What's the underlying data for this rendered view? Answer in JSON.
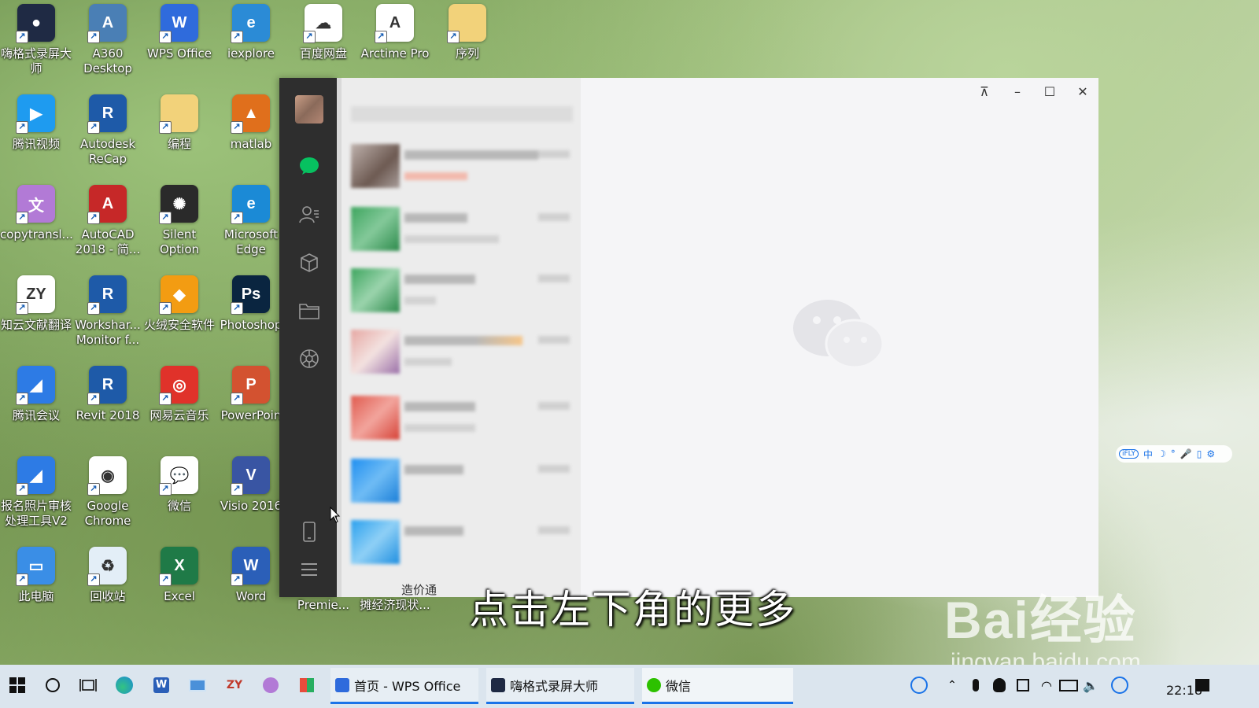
{
  "desktop_icons": [
    {
      "label": "嗨格式录屏大\n师",
      "icon": "screen-recorder-icon",
      "color": "#1f2a44",
      "glyph": "●"
    },
    {
      "label": "A360\nDesktop",
      "icon": "a360-icon",
      "color": "#4a7fb5",
      "glyph": "A"
    },
    {
      "label": "WPS Office",
      "icon": "wps-icon",
      "color": "#2f6bdc",
      "glyph": "W"
    },
    {
      "label": "iexplore",
      "icon": "internet-explorer-icon",
      "color": "#2b8bd6",
      "glyph": "e"
    },
    {
      "label": "百度网盘",
      "icon": "baidu-netdisk-icon",
      "color": "#ffffff",
      "glyph": "☁"
    },
    {
      "label": "Arctime Pro",
      "icon": "arctime-icon",
      "color": "#ffffff",
      "glyph": "A"
    },
    {
      "label": "序列",
      "icon": "folder-icon",
      "color": "#f2d27a",
      "glyph": ""
    },
    {
      "label": "腾讯视频",
      "icon": "tencent-video-icon",
      "color": "#1e9bf0",
      "glyph": "▶"
    },
    {
      "label": "Autodesk\nReCap",
      "icon": "revit-recap-icon",
      "color": "#1e5aa8",
      "glyph": "R"
    },
    {
      "label": "编程",
      "icon": "folder-icon",
      "color": "#f2d27a",
      "glyph": ""
    },
    {
      "label": "matlab",
      "icon": "matlab-icon",
      "color": "#e06f1c",
      "glyph": "▲"
    },
    {
      "label": "copytransl...",
      "icon": "copytranslator-icon",
      "color": "#b27ad6",
      "glyph": "文"
    },
    {
      "label": "AutoCAD\n2018 - 简...",
      "icon": "autocad-icon",
      "color": "#c62828",
      "glyph": "A"
    },
    {
      "label": "Silent\nOption",
      "icon": "silent-option-icon",
      "color": "#2a2a2a",
      "glyph": "✺"
    },
    {
      "label": "Microsoft\nEdge",
      "icon": "edge-icon",
      "color": "#1b8ad6",
      "glyph": "e"
    },
    {
      "label": "知云文献翻译",
      "icon": "zhiyun-icon",
      "color": "#ffffff",
      "glyph": "ZY"
    },
    {
      "label": "Workshar...\nMonitor f...",
      "icon": "workshare-monitor-icon",
      "color": "#1e5aa8",
      "glyph": "R"
    },
    {
      "label": "火绒安全软件",
      "icon": "huorong-icon",
      "color": "#f39c12",
      "glyph": "◆"
    },
    {
      "label": "Photoshop",
      "icon": "photoshop-icon",
      "color": "#0a2540",
      "glyph": "Ps"
    },
    {
      "label": "腾讯会议",
      "icon": "tencent-meeting-icon",
      "color": "#2d7be5",
      "glyph": "◢"
    },
    {
      "label": "Revit 2018",
      "icon": "revit-icon",
      "color": "#1e5aa8",
      "glyph": "R"
    },
    {
      "label": "网易云音乐",
      "icon": "netease-music-icon",
      "color": "#e0322a",
      "glyph": "◎"
    },
    {
      "label": "PowerPoin",
      "icon": "powerpoint-icon",
      "color": "#d35230",
      "glyph": "P"
    },
    {
      "label": "报名照片审核\n处理工具V2",
      "icon": "photo-audit-icon",
      "color": "#2d7be5",
      "glyph": "◢"
    },
    {
      "label": "Google\nChrome",
      "icon": "chrome-icon",
      "color": "#ffffff",
      "glyph": "◉"
    },
    {
      "label": "微信",
      "icon": "wechat-icon",
      "color": "#ffffff",
      "glyph": "💬"
    },
    {
      "label": "Visio 2016",
      "icon": "visio-icon",
      "color": "#3955a3",
      "glyph": "V"
    },
    {
      "label": "此电脑",
      "icon": "this-pc-icon",
      "color": "#3a8ee6",
      "glyph": "▭"
    },
    {
      "label": "回收站",
      "icon": "recycle-bin-icon",
      "color": "#e3eef7",
      "glyph": "♻"
    },
    {
      "label": "Excel",
      "icon": "excel-icon",
      "color": "#1f7a47",
      "glyph": "X"
    },
    {
      "label": "Word",
      "icon": "word-icon",
      "color": "#2b5fb8",
      "glyph": "W"
    }
  ],
  "partial_icons": [
    {
      "label": "Adobe\nPremie..."
    },
    {
      "label": "后疫情时代地\n摊经济现状..."
    }
  ],
  "chat_list": {
    "preview_label": "造价通"
  },
  "subtitle": "点击左下角的更多",
  "ime_bar": {
    "logo": "iFLY",
    "items": [
      "中",
      "☽",
      "°",
      "🎤",
      "▯",
      "⚙"
    ]
  },
  "watermark": {
    "line1": "Bai经验",
    "line2": "jingyan.baidu.com"
  },
  "taskbar": {
    "tasks": [
      {
        "label": "首页 - WPS Office",
        "color": "#2f6bdc"
      },
      {
        "label": "嗨格式录屏大师",
        "color": "#1f2a44"
      },
      {
        "label": "微信",
        "color": "#2dc100"
      }
    ],
    "clock": "22:18"
  }
}
